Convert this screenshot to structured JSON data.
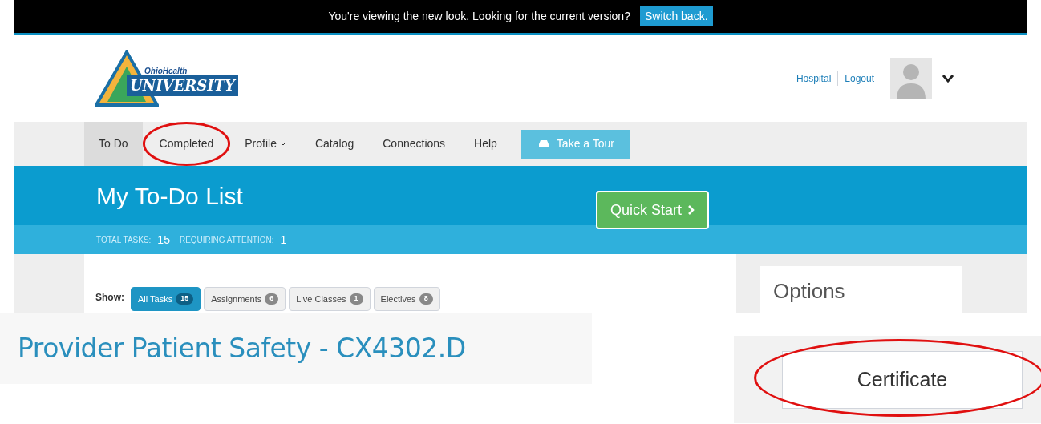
{
  "banner": {
    "message": "You're viewing the new look. Looking for the current version?",
    "button": "Switch back."
  },
  "logo": {
    "small": "OhioHealth",
    "large": "UNIVERSITY"
  },
  "header_links": [
    "Hospital",
    "Logout"
  ],
  "nav": [
    {
      "label": "To Do",
      "selected": true,
      "circled": false,
      "dropdown": false
    },
    {
      "label": "Completed",
      "selected": false,
      "circled": true,
      "dropdown": false
    },
    {
      "label": "Profile",
      "selected": false,
      "circled": false,
      "dropdown": true
    },
    {
      "label": "Catalog",
      "selected": false,
      "circled": false,
      "dropdown": false
    },
    {
      "label": "Connections",
      "selected": false,
      "circled": false,
      "dropdown": false
    },
    {
      "label": "Help",
      "selected": false,
      "circled": false,
      "dropdown": false
    }
  ],
  "tour_button": "Take a Tour",
  "page_title": "My To-Do List",
  "quick_start": "Quick Start",
  "stats": [
    {
      "label": "TOTAL TASKS:",
      "value": "15"
    },
    {
      "label": "REQUIRING ATTENTION:",
      "value": "1"
    }
  ],
  "filter_label": "Show:",
  "filters": [
    {
      "label": "All Tasks",
      "count": "15",
      "selected": true
    },
    {
      "label": "Assignments",
      "count": "6",
      "selected": false
    },
    {
      "label": "Live Classes",
      "count": "1",
      "selected": false
    },
    {
      "label": "Electives",
      "count": "8",
      "selected": false
    }
  ],
  "options_title": "Options",
  "course_title": "Provider Patient Safety - CX4302.D",
  "certificate": {
    "label": "Certificate",
    "circled": true
  }
}
